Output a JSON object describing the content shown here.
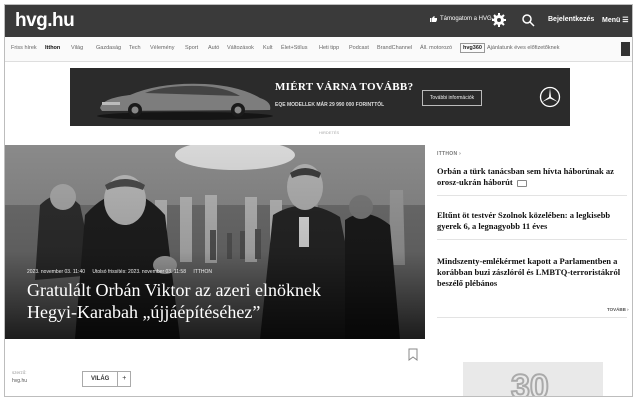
{
  "header": {
    "logo": "hvg.hu",
    "subscribe": "Támogatom a HVG-t",
    "login": "Bejelentkezés",
    "menu": "Menü ☰"
  },
  "nav": {
    "items": [
      "Friss hírek",
      "Itthon",
      "Világ",
      "Gazdaság",
      "Tech",
      "Vélemény",
      "Sport",
      "Autó",
      "Változások",
      "Kult",
      "Élet+Stílus",
      "Heti tipp",
      "Podcast",
      "BrandChannel",
      "Áll. motorozó",
      "hvg360",
      "Ajánlatunk éves előfizetőknek"
    ],
    "active": "Itthon",
    "boxed": "hvg360"
  },
  "ad": {
    "title": "MIÉRT VÁRNA TOVÁBB?",
    "subtitle": "EQE MODELLEK MÁR 29 990 000 FORINTTÓL",
    "button": "További információk",
    "label": "HIRDETÉS"
  },
  "hero": {
    "published": "2023. november 03. 11:40",
    "updated": "Utolsó frissítés: 2023. november 03. 11:58",
    "section": "ITTHON",
    "title": "Gratulált Orbán Viktor az azeri elnöknek Hegyi-Karabah „újjáépítéséhez”"
  },
  "meta": {
    "source_label": "szerző:",
    "source": "hvg.hu",
    "tag": "VILÁG",
    "tag_add": "+"
  },
  "side": {
    "kicker": "ITTHON ›",
    "items": [
      "Orbán a türk tanácsban sem hívta háborúnak az orosz-ukrán háborút",
      "Eltűnt öt testvér Szolnok közelében: a legkisebb gyerek 6, a legnagyobb 11 éves",
      "Mindszenty-emlékérmet kapott a Parlamentben a korábban buzi zászlóról és LMBTQ-terroristákról beszélő plébános"
    ],
    "more": "TOVÁBB ›",
    "ad_text": "30"
  }
}
